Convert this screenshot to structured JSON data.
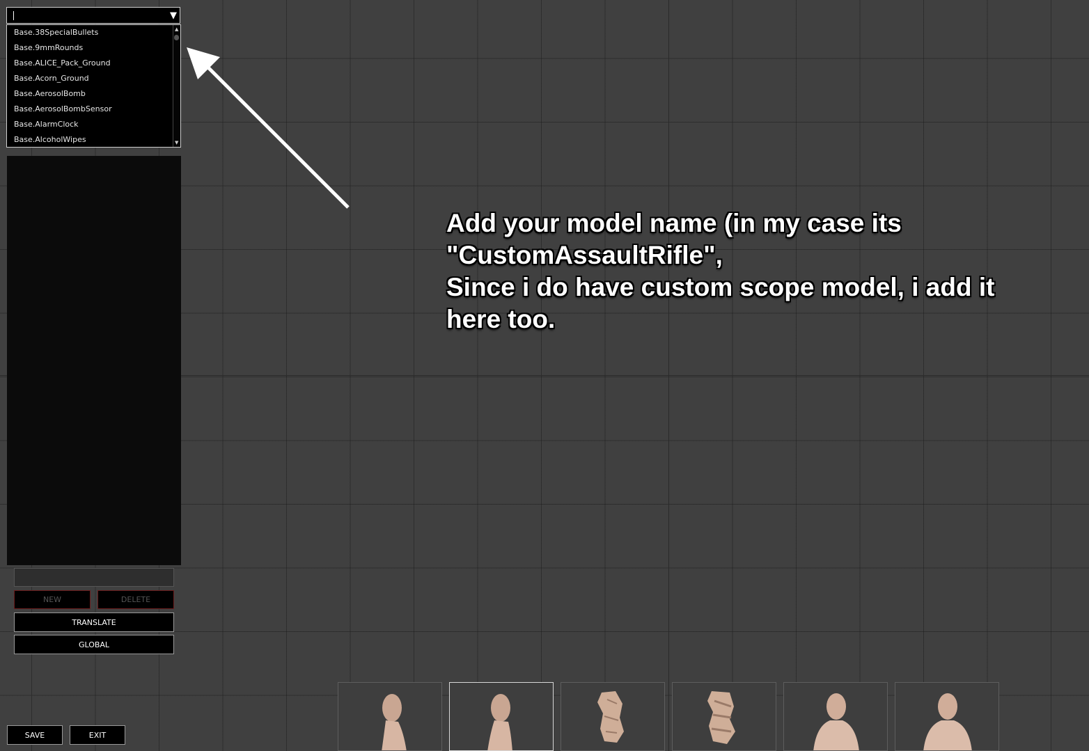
{
  "item_selector": {
    "input_value": "",
    "options": [
      "Base.38SpecialBullets",
      "Base.9mmRounds",
      "Base.ALICE_Pack_Ground",
      "Base.Acorn_Ground",
      "Base.AerosolBomb",
      "Base.AerosolBombSensor",
      "Base.AlarmClock",
      "Base.AlcoholWipes"
    ]
  },
  "buttons": {
    "new": "NEW",
    "delete": "DELETE",
    "translate": "TRANSLATE",
    "global": "GLOBAL",
    "save": "SAVE",
    "exit": "EXIT"
  },
  "annotation": {
    "text": "Add your model name (in my case its\n\"CustomAssaultRifle\",\nSince i do have custom scope model, i add it\nhere too."
  },
  "preview_thumbnails": {
    "count": 6,
    "selected_index": 1,
    "views": [
      "body-side-left",
      "body-side-right",
      "hand-top",
      "hand-bottom",
      "body-front",
      "body-back"
    ]
  }
}
